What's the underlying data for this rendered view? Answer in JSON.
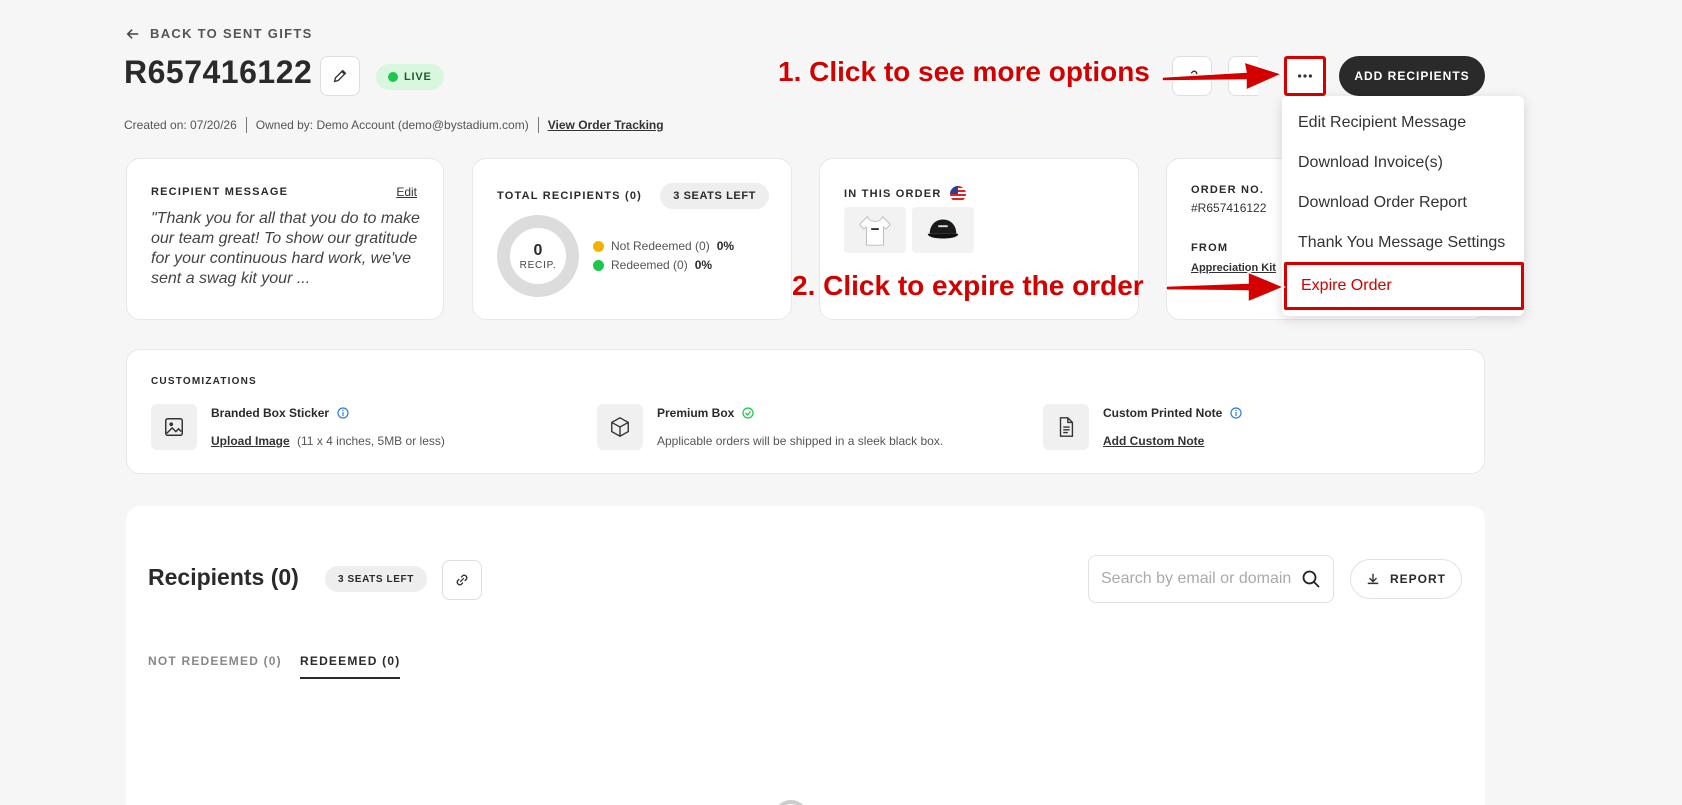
{
  "header": {
    "back_label": "BACK TO SENT GIFTS",
    "order_id": "R657416122",
    "status": "LIVE",
    "created_on": "Created on: 07/20/26",
    "owned_by": "Owned by: Demo Account (demo@bystadium.com)",
    "view_tracking": "View Order Tracking",
    "add_recipients": "ADD RECIPIENTS"
  },
  "menu": {
    "items": [
      "Edit Recipient Message",
      "Download Invoice(s)",
      "Download Order Report",
      "Thank You Message Settings"
    ],
    "expire": "Expire Order"
  },
  "annotations": {
    "step1": "1. Click to see more options",
    "step2": "2. Click to expire the order",
    "color": "#d40000"
  },
  "message_card": {
    "label": "RECIPIENT MESSAGE",
    "edit": "Edit",
    "text": "\"Thank you for all that you do to make our team great! To show our gratitude for your continuous hard work, we've sent a swag kit your ..."
  },
  "recipients_card": {
    "label": "TOTAL RECIPIENTS (0)",
    "seats": "3 SEATS LEFT",
    "count": "0",
    "unit": "RECIP.",
    "legend": [
      {
        "label": "Not Redeemed (0)",
        "pct": "0%",
        "color": "#f2b300"
      },
      {
        "label": "Redeemed (0)",
        "pct": "0%",
        "color": "#1ec74b"
      }
    ]
  },
  "order_card": {
    "label": "IN THIS ORDER",
    "products": [
      "hoodie-icon",
      "cap-icon"
    ]
  },
  "order_no_card": {
    "label": "ORDER NO.",
    "value": "#R657416122",
    "from_label": "FROM",
    "from_value": "Appreciation Kit"
  },
  "customizations": {
    "label": "CUSTOMIZATIONS",
    "items": [
      {
        "title": "Branded Box Sticker",
        "link": "Upload Image",
        "note": "(11 x 4 inches, 5MB or less)"
      },
      {
        "title": "Premium Box",
        "note": "Applicable orders will be shipped in a sleek black box."
      },
      {
        "title": "Custom Printed Note",
        "link": "Add Custom Note"
      }
    ]
  },
  "recipients": {
    "title": "Recipients (0)",
    "seats": "3 SEATS LEFT",
    "search_placeholder": "Search by email or domain",
    "report": "REPORT",
    "tabs": [
      "NOT REDEEMED (0)",
      "REDEEMED (0)"
    ]
  }
}
